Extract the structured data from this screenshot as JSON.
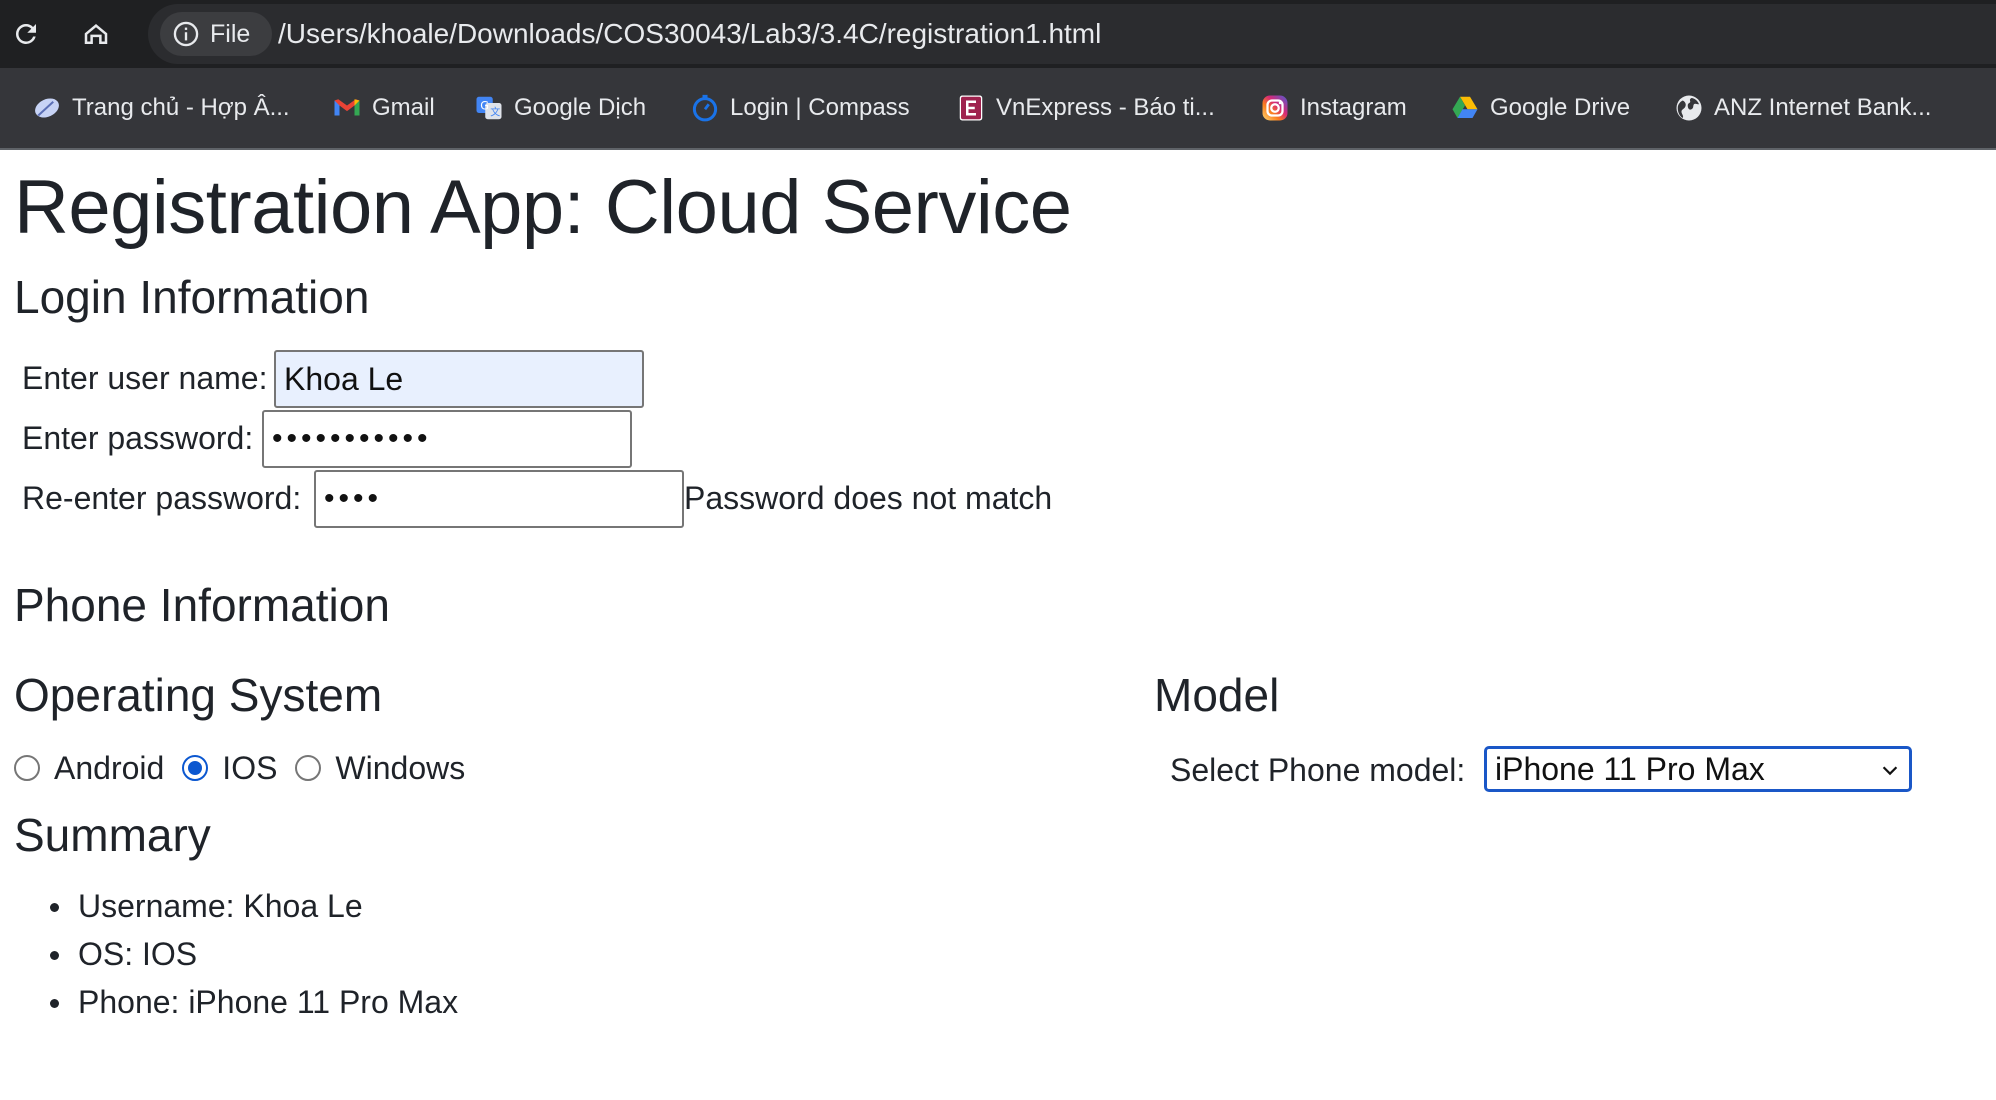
{
  "browser": {
    "site_chip_label": "File",
    "url": "/Users/khoale/Downloads/COS30043/Lab3/3.4C/registration1.html",
    "bookmarks": [
      {
        "label": "Trang chủ - Hợp Â...",
        "icon": "feather-icon"
      },
      {
        "label": "Gmail",
        "icon": "gmail-icon"
      },
      {
        "label": "Google Dịch",
        "icon": "google-translate-icon"
      },
      {
        "label": "Login | Compass",
        "icon": "compass-icon"
      },
      {
        "label": "VnExpress - Báo ti...",
        "icon": "vnexpress-icon"
      },
      {
        "label": "Instagram",
        "icon": "instagram-icon"
      },
      {
        "label": "Google Drive",
        "icon": "google-drive-icon"
      },
      {
        "label": "ANZ Internet Bank...",
        "icon": "globe-icon"
      }
    ]
  },
  "page": {
    "title": "Registration App: Cloud Service",
    "login": {
      "heading": "Login Information",
      "username_label": "Enter user name:",
      "username_value": "Khoa Le",
      "password_label": "Enter password:",
      "password_value": "•••••••••••",
      "reenter_label": "Re-enter password:",
      "reenter_value": "••••",
      "mismatch_message": "Password does not match"
    },
    "phone": {
      "heading": "Phone Information",
      "os_heading": "Operating System",
      "os_options": [
        "Android",
        "IOS",
        "Windows"
      ],
      "os_selected": "IOS",
      "model_heading": "Model",
      "model_label": "Select Phone model:",
      "model_selected": "iPhone 11 Pro Max"
    },
    "summary": {
      "heading": "Summary",
      "items": [
        "Username: Khoa Le",
        "OS: IOS",
        "Phone: iPhone 11 Pro Max"
      ]
    }
  },
  "colors": {
    "chrome_dark": "#1f2022",
    "bookmark_bar": "#35363a",
    "accent": "#0b57d0",
    "autofill": "#e8f0fe"
  }
}
